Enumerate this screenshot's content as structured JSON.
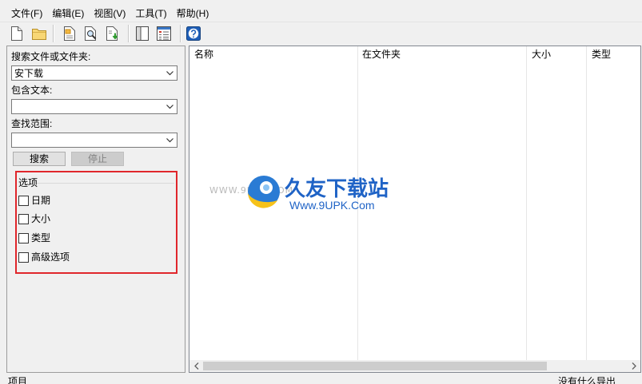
{
  "menu": [
    {
      "label": "文件(F)"
    },
    {
      "label": "编辑(E)"
    },
    {
      "label": "视图(V)"
    },
    {
      "label": "工具(T)"
    },
    {
      "label": "帮助(H)"
    }
  ],
  "toolbar": {
    "buttons": [
      {
        "icon": "new-file-icon"
      },
      {
        "icon": "open-folder-icon"
      },
      {
        "icon": "report-document-icon"
      },
      {
        "icon": "find-document-icon"
      },
      {
        "icon": "export-document-icon"
      },
      {
        "icon": "panel-layout-icon"
      },
      {
        "icon": "details-view-icon"
      },
      {
        "icon": "help-icon"
      }
    ]
  },
  "search_panel": {
    "name_label": "搜索文件或文件夹:",
    "name_value": "安下载",
    "text_label": "包含文本:",
    "text_value": "",
    "scope_label": "查找范围:",
    "scope_value": "",
    "search_button": "搜索",
    "stop_button": {
      "label": "停止",
      "disabled": true
    },
    "options": {
      "title": "选项",
      "items": [
        {
          "label": "日期",
          "checked": false
        },
        {
          "label": "大小",
          "checked": false
        },
        {
          "label": "类型",
          "checked": false
        },
        {
          "label": "高级选项",
          "checked": false
        }
      ]
    }
  },
  "results": {
    "columns": [
      "名称",
      "在文件夹",
      "大小",
      "类型"
    ],
    "rows": []
  },
  "status_bar": {
    "left": "项目",
    "right": "没有什么导出"
  },
  "watermark": {
    "brand": "久友下载站",
    "url": "Www.9UPK.Com",
    "faint_url": "WWW.9UPK.COM"
  },
  "colors": {
    "window_background": "#f0f0f0",
    "list_background": "#ffffff",
    "highlight_box": "#e0262b",
    "watermark_blue": "#1f63c6"
  }
}
